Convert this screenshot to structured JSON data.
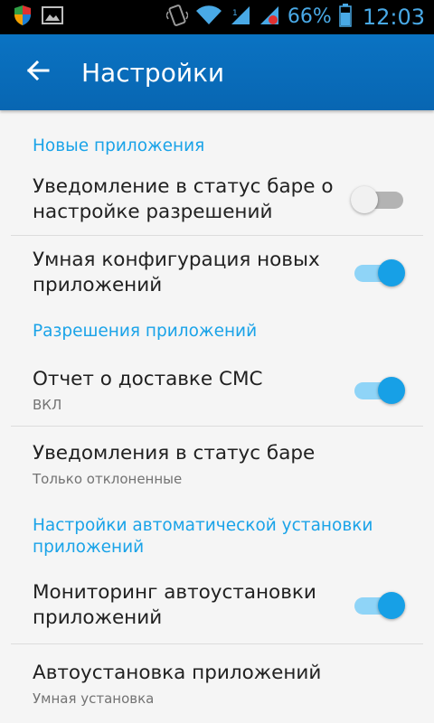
{
  "status_bar": {
    "icons": [
      "shield-icon",
      "image-icon",
      "vibrate-icon",
      "wifi-icon",
      "signal-icon-1",
      "signal-icon-2",
      "battery-icon"
    ],
    "battery_percent": "66%",
    "time": "12:03",
    "accent_color": "#49a9e6"
  },
  "toolbar": {
    "title": "Настройки",
    "back_icon": "arrow-back-icon",
    "color": "#0a6dbb"
  },
  "sections": {
    "new_apps": {
      "header": "Новые приложения",
      "items": [
        {
          "title": "Уведомление в статус баре о настройке разрешений",
          "toggle": false
        },
        {
          "title": "Умная конфигурация новых приложений",
          "toggle": true
        }
      ]
    },
    "app_permissions": {
      "header": "Разрешения приложений",
      "items": [
        {
          "title": "Отчет о доставке СМС",
          "subtitle": "ВКЛ",
          "toggle": true
        },
        {
          "title": "Уведомления в статус баре",
          "subtitle": "Только отклоненные"
        }
      ]
    },
    "auto_install": {
      "header": "Настройки автоматической установки приложений",
      "items": [
        {
          "title": "Мониторинг автоустановки приложений",
          "toggle": true
        },
        {
          "title": "Автоустановка приложений",
          "subtitle": "Умная установка"
        }
      ]
    }
  },
  "colors": {
    "section_header": "#1aa3e8",
    "switch_on": "#17a0e6",
    "switch_off_track": "#b3b3b3"
  }
}
